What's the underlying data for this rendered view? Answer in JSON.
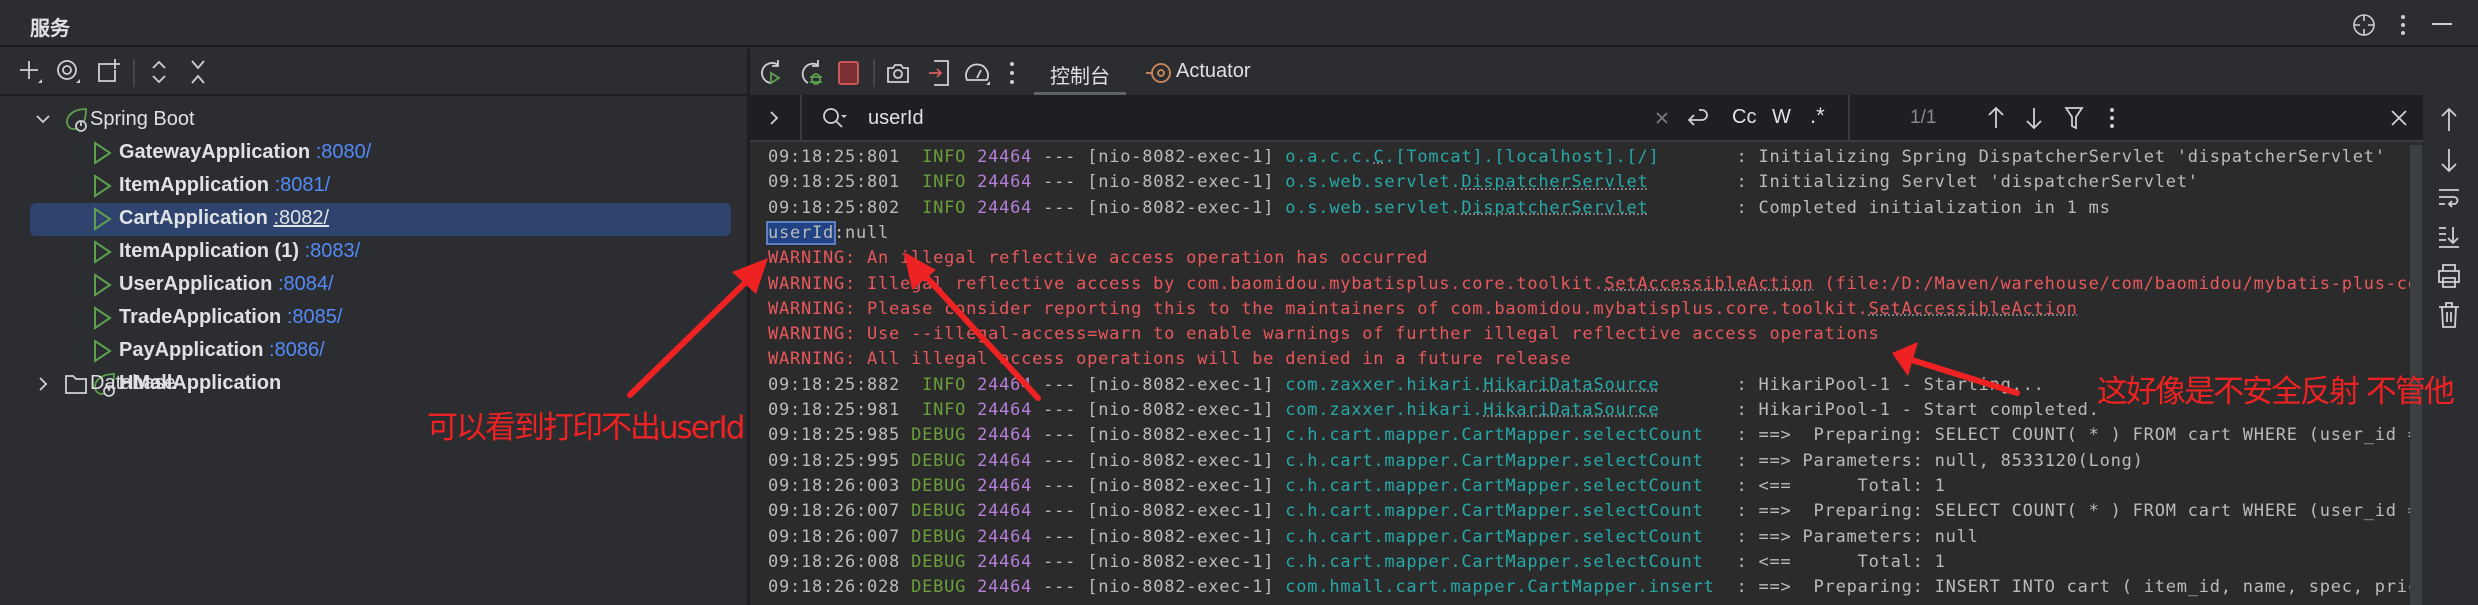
{
  "header": {
    "title": "服务",
    "icons": [
      "crosshair-icon",
      "more-vertical-icon",
      "minimize-icon"
    ]
  },
  "left_toolbar": {
    "icons": [
      "add-icon",
      "eye-icon",
      "new-group-icon",
      "expand-all-icon",
      "collapse-all-icon"
    ]
  },
  "tree": {
    "root": {
      "label": "Spring Boot",
      "icon": "spring-boot-icon",
      "expanded": true
    },
    "apps": [
      {
        "name": "GatewayApplication",
        "port": ":8080/",
        "icon": "run-icon"
      },
      {
        "name": "ItemApplication",
        "port": ":8081/",
        "icon": "run-icon"
      },
      {
        "name": "CartApplication",
        "port": ":8082/",
        "icon": "run-icon",
        "selected": true
      },
      {
        "name": "ItemApplication (1)",
        "port": ":8083/",
        "icon": "run-icon"
      },
      {
        "name": "UserApplication",
        "port": ":8084/",
        "icon": "run-icon"
      },
      {
        "name": "TradeApplication",
        "port": ":8085/",
        "icon": "run-icon"
      },
      {
        "name": "PayApplication",
        "port": ":8086/",
        "icon": "run-icon"
      },
      {
        "name": "HMallApplication",
        "port": "",
        "icon": "spring-boot-icon"
      }
    ],
    "database": {
      "label": "Database",
      "expanded": false
    }
  },
  "console_toolbar": {
    "icons": [
      "rerun-icon",
      "debug-rerun-icon",
      "stop-icon",
      "screenshot-icon",
      "login-icon",
      "profiler-icon",
      "more-vertical-icon"
    ],
    "tabs": [
      {
        "label": "控制台",
        "active": true
      },
      {
        "label": "Actuator",
        "icon": "actuator-icon"
      }
    ]
  },
  "search": {
    "value": "userId",
    "match_count": "1/1",
    "options": [
      "Cc",
      "W",
      ".*"
    ]
  },
  "lines": [
    {
      "type": "log",
      "time": "09:18:25:801",
      "level": "INFO",
      "pid": "24464",
      "thread": "[nio-8082-exec-1]",
      "logger_pkg": "o.a.c.c.",
      "logger_cls": "C",
      "logger_suffix": ".[Tomcat].[localhost].[/]",
      "message": "Initializing Spring DispatcherServlet 'dispatcherServlet'"
    },
    {
      "type": "log",
      "time": "09:18:25:801",
      "level": "INFO",
      "pid": "24464",
      "thread": "[nio-8082-exec-1]",
      "logger_pkg": "o.s.web.servlet.",
      "logger_cls": "DispatcherServlet",
      "logger_suffix": "",
      "message": "Initializing Servlet 'dispatcherServlet'"
    },
    {
      "type": "log",
      "time": "09:18:25:802",
      "level": "INFO",
      "pid": "24464",
      "thread": "[nio-8082-exec-1]",
      "logger_pkg": "o.s.web.servlet.",
      "logger_cls": "DispatcherServlet",
      "logger_suffix": "",
      "message": "Completed initialization in 1 ms"
    },
    {
      "type": "plain",
      "parts": [
        {
          "text": "userId",
          "highlight": true
        },
        {
          "text": ":null"
        }
      ]
    },
    {
      "type": "warn",
      "parts": [
        {
          "text": "WARNING: An illegal reflective access operation has occurred"
        }
      ]
    },
    {
      "type": "warn",
      "parts": [
        {
          "text": "WARNING: Illegal reflective access by com.baomidou.mybatisplus.core.toolkit."
        },
        {
          "text": "SetAccessibleAction",
          "link": true
        },
        {
          "text": " (file:/D:/Maven/warehouse/com/baomidou/mybatis-plus-cor"
        }
      ]
    },
    {
      "type": "warn",
      "parts": [
        {
          "text": "WARNING: Please consider reporting this to the maintainers of com.baomidou.mybatisplus.core.toolkit."
        },
        {
          "text": "SetAccessibleAction",
          "link": true
        }
      ]
    },
    {
      "type": "warn",
      "parts": [
        {
          "text": "WARNING: Use --illegal-access=warn to enable warnings of further illegal reflective access operations"
        }
      ]
    },
    {
      "type": "warn",
      "parts": [
        {
          "text": "WARNING: All illegal access operations will be denied in a future release"
        }
      ]
    },
    {
      "type": "log",
      "time": "09:18:25:882",
      "level": "INFO",
      "pid": "24464",
      "thread": "[nio-8082-exec-1]",
      "logger_pkg": "com.zaxxer.hikari.",
      "logger_cls": "HikariDataSource",
      "logger_suffix": "",
      "message": "HikariPool-1 - Starting..."
    },
    {
      "type": "log",
      "time": "09:18:25:981",
      "level": "INFO",
      "pid": "24464",
      "thread": "[nio-8082-exec-1]",
      "logger_pkg": "com.zaxxer.hikari.",
      "logger_cls": "HikariDataSource",
      "logger_suffix": "",
      "message": "HikariPool-1 - Start completed."
    },
    {
      "type": "log",
      "time": "09:18:25:985",
      "level": "DEBUG",
      "pid": "24464",
      "thread": "[nio-8082-exec-1]",
      "logger_pkg": "c.h.cart.mapper.CartMapper.selectCount",
      "logger_cls": "",
      "logger_suffix": "",
      "message": "==>  Preparing: SELECT COUNT( * ) FROM cart WHERE (user_id ="
    },
    {
      "type": "log",
      "time": "09:18:25:995",
      "level": "DEBUG",
      "pid": "24464",
      "thread": "[nio-8082-exec-1]",
      "logger_pkg": "c.h.cart.mapper.CartMapper.selectCount",
      "logger_cls": "",
      "logger_suffix": "",
      "message": "==> Parameters: null, 8533120(Long)"
    },
    {
      "type": "log",
      "time": "09:18:26:003",
      "level": "DEBUG",
      "pid": "24464",
      "thread": "[nio-8082-exec-1]",
      "logger_pkg": "c.h.cart.mapper.CartMapper.selectCount",
      "logger_cls": "",
      "logger_suffix": "",
      "message": "<==      Total: 1"
    },
    {
      "type": "log",
      "time": "09:18:26:007",
      "level": "DEBUG",
      "pid": "24464",
      "thread": "[nio-8082-exec-1]",
      "logger_pkg": "c.h.cart.mapper.CartMapper.selectCount",
      "logger_cls": "",
      "logger_suffix": "",
      "message": "==>  Preparing: SELECT COUNT( * ) FROM cart WHERE (user_id ="
    },
    {
      "type": "log",
      "time": "09:18:26:007",
      "level": "DEBUG",
      "pid": "24464",
      "thread": "[nio-8082-exec-1]",
      "logger_pkg": "c.h.cart.mapper.CartMapper.selectCount",
      "logger_cls": "",
      "logger_suffix": "",
      "message": "==> Parameters: null"
    },
    {
      "type": "log",
      "time": "09:18:26:008",
      "level": "DEBUG",
      "pid": "24464",
      "thread": "[nio-8082-exec-1]",
      "logger_pkg": "c.h.cart.mapper.CartMapper.selectCount",
      "logger_cls": "",
      "logger_suffix": "",
      "message": "<==      Total: 1"
    },
    {
      "type": "log",
      "time": "09:18:26:028",
      "level": "DEBUG",
      "pid": "24464",
      "thread": "[nio-8082-exec-1]",
      "logger_pkg": "com.hmall.cart.mapper.CartMapper.insert",
      "logger_cls": "",
      "logger_suffix": "",
      "message": "==>  Preparing: INSERT INTO cart ( item_id, name, spec, price"
    }
  ],
  "right_toolbar": {
    "icons": [
      "scroll-up-icon",
      "scroll-down-icon",
      "soft-wrap-icon",
      "scroll-to-end-icon",
      "print-icon",
      "clear-icon"
    ]
  },
  "annotations": [
    {
      "text": "可以看到打印不出userId"
    },
    {
      "text": "这好像是不安全反射 不管他"
    }
  ],
  "colors": {
    "accent": "#548af7",
    "selection": "#2e436e",
    "warning": "#e8585c",
    "info": "#6a9f3a",
    "annotation": "#ee2222"
  }
}
